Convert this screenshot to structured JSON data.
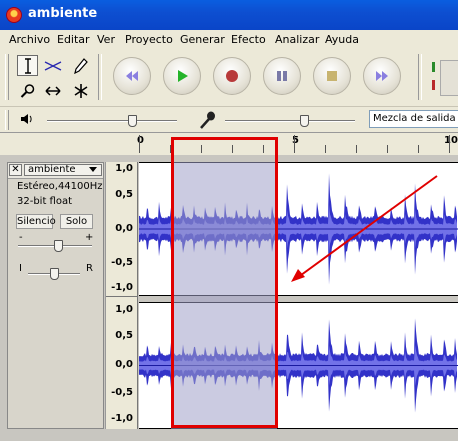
{
  "window": {
    "title": "ambiente"
  },
  "menu": [
    "Archivo",
    "Editar",
    "Ver",
    "Proyecto",
    "Generar",
    "Efecto",
    "Analizar",
    "Ayuda"
  ],
  "tools": {
    "selection": "I-beam-icon",
    "envelope": "envelope-icon",
    "draw": "pencil-icon",
    "zoom": "magnifier-icon",
    "timeshift": "double-arrow-icon",
    "multi": "asterisk-icon"
  },
  "transport": {
    "skip_start": "skip-to-start-icon",
    "play": "play-icon",
    "record": "record-icon",
    "pause": "pause-icon",
    "stop": "stop-icon",
    "skip_end": "skip-to-end-icon"
  },
  "mixer": {
    "output_icon": "speaker-icon",
    "input_icon": "microphone-icon",
    "output_volume": 0.67,
    "input_volume": 0.62,
    "input_source": "Mezcla de salida de"
  },
  "ruler": {
    "labels": [
      "0",
      "5",
      "10"
    ]
  },
  "track": {
    "name": "ambiente",
    "format": "Estéreo,44100Hz",
    "bits": "32-bit float",
    "mute_label": "Silencio",
    "solo_label": "Solo",
    "gain_minus": "-",
    "gain_plus": "+",
    "pan_left": "I",
    "pan_right": "R",
    "gain": 0.55,
    "pan": 0.5
  },
  "scale": {
    "labels": [
      "1,0",
      "0,5",
      "0,0",
      "-0,5",
      "-1,0"
    ]
  },
  "colors": {
    "waveform": "#3232c8",
    "selection_highlight": "#a0a0c8",
    "annotation": "#e00000"
  }
}
